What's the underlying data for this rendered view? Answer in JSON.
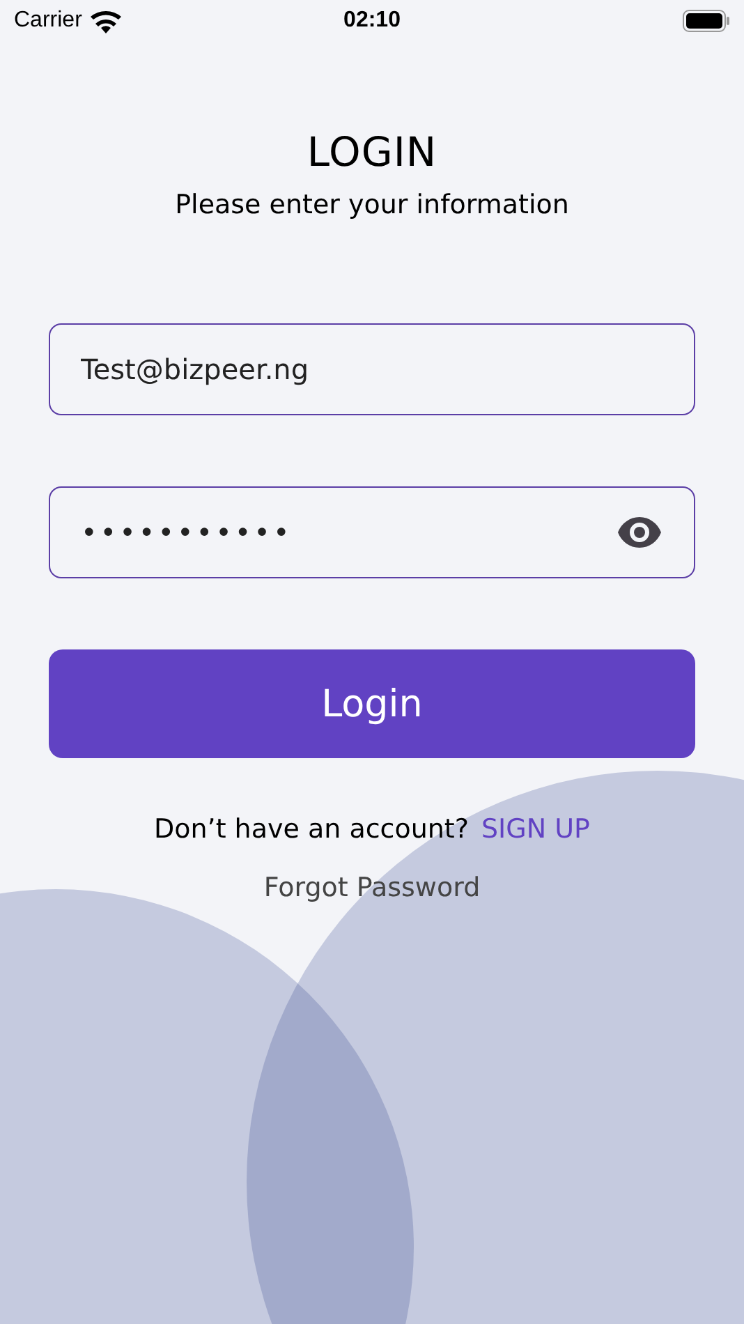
{
  "status_bar": {
    "carrier": "Carrier",
    "time": "02:10"
  },
  "title": "LOGIN",
  "subtitle": "Please enter your information",
  "email_field": {
    "value": "Test@bizpeer.ng"
  },
  "password_field": {
    "value": "•••••••••••",
    "show_toggle": true
  },
  "login_button": "Login",
  "signup_prompt": {
    "text": "Don’t have an account?",
    "link": "SIGN UP"
  },
  "forgot_password": "Forgot Password"
}
